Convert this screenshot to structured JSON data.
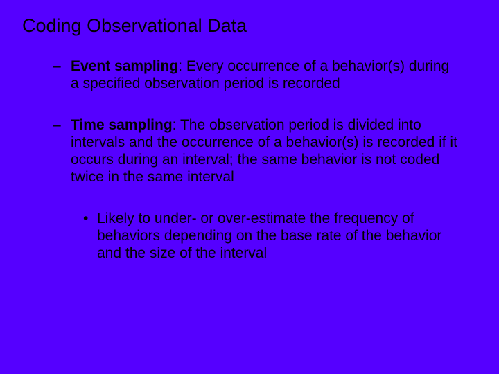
{
  "title": "Coding Observational Data",
  "bullets": [
    {
      "term": "Event sampling",
      "definition": ":  Every occurrence of a behavior(s) during a specified observation period is recorded"
    },
    {
      "term": "Time sampling",
      "definition": ":  The observation period is divided into intervals and the occurrence of a behavior(s) is recorded if it occurs during an interval; the same behavior is not coded twice in the same interval"
    }
  ],
  "subbullet": "Likely to under- or over-estimate the frequency of behaviors depending on the base rate of the behavior and the size of the interval",
  "markers": {
    "dash": "–",
    "dot": "•"
  }
}
